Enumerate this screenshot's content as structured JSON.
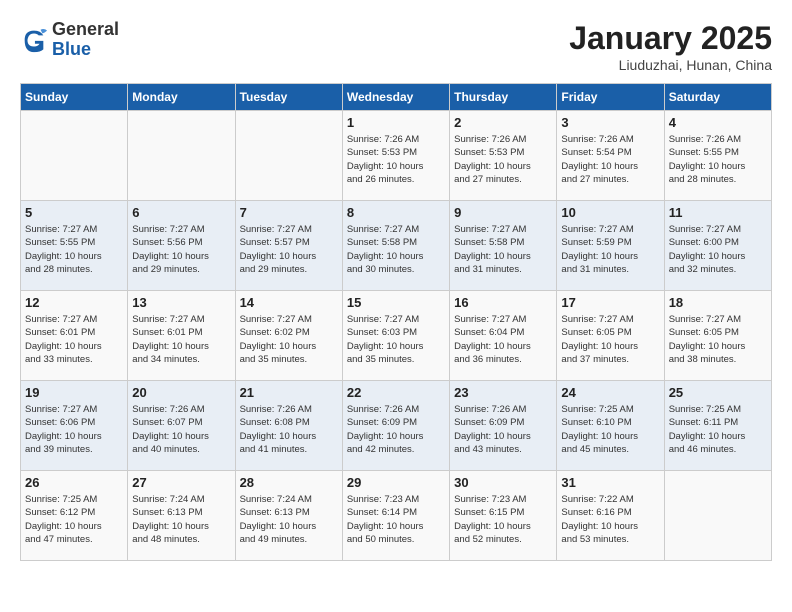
{
  "header": {
    "logo_general": "General",
    "logo_blue": "Blue",
    "title": "January 2025",
    "subtitle": "Liuduzhai, Hunan, China"
  },
  "weekdays": [
    "Sunday",
    "Monday",
    "Tuesday",
    "Wednesday",
    "Thursday",
    "Friday",
    "Saturday"
  ],
  "weeks": [
    [
      {
        "day": "",
        "info": ""
      },
      {
        "day": "",
        "info": ""
      },
      {
        "day": "",
        "info": ""
      },
      {
        "day": "1",
        "info": "Sunrise: 7:26 AM\nSunset: 5:53 PM\nDaylight: 10 hours\nand 26 minutes."
      },
      {
        "day": "2",
        "info": "Sunrise: 7:26 AM\nSunset: 5:53 PM\nDaylight: 10 hours\nand 27 minutes."
      },
      {
        "day": "3",
        "info": "Sunrise: 7:26 AM\nSunset: 5:54 PM\nDaylight: 10 hours\nand 27 minutes."
      },
      {
        "day": "4",
        "info": "Sunrise: 7:26 AM\nSunset: 5:55 PM\nDaylight: 10 hours\nand 28 minutes."
      }
    ],
    [
      {
        "day": "5",
        "info": "Sunrise: 7:27 AM\nSunset: 5:55 PM\nDaylight: 10 hours\nand 28 minutes."
      },
      {
        "day": "6",
        "info": "Sunrise: 7:27 AM\nSunset: 5:56 PM\nDaylight: 10 hours\nand 29 minutes."
      },
      {
        "day": "7",
        "info": "Sunrise: 7:27 AM\nSunset: 5:57 PM\nDaylight: 10 hours\nand 29 minutes."
      },
      {
        "day": "8",
        "info": "Sunrise: 7:27 AM\nSunset: 5:58 PM\nDaylight: 10 hours\nand 30 minutes."
      },
      {
        "day": "9",
        "info": "Sunrise: 7:27 AM\nSunset: 5:58 PM\nDaylight: 10 hours\nand 31 minutes."
      },
      {
        "day": "10",
        "info": "Sunrise: 7:27 AM\nSunset: 5:59 PM\nDaylight: 10 hours\nand 31 minutes."
      },
      {
        "day": "11",
        "info": "Sunrise: 7:27 AM\nSunset: 6:00 PM\nDaylight: 10 hours\nand 32 minutes."
      }
    ],
    [
      {
        "day": "12",
        "info": "Sunrise: 7:27 AM\nSunset: 6:01 PM\nDaylight: 10 hours\nand 33 minutes."
      },
      {
        "day": "13",
        "info": "Sunrise: 7:27 AM\nSunset: 6:01 PM\nDaylight: 10 hours\nand 34 minutes."
      },
      {
        "day": "14",
        "info": "Sunrise: 7:27 AM\nSunset: 6:02 PM\nDaylight: 10 hours\nand 35 minutes."
      },
      {
        "day": "15",
        "info": "Sunrise: 7:27 AM\nSunset: 6:03 PM\nDaylight: 10 hours\nand 35 minutes."
      },
      {
        "day": "16",
        "info": "Sunrise: 7:27 AM\nSunset: 6:04 PM\nDaylight: 10 hours\nand 36 minutes."
      },
      {
        "day": "17",
        "info": "Sunrise: 7:27 AM\nSunset: 6:05 PM\nDaylight: 10 hours\nand 37 minutes."
      },
      {
        "day": "18",
        "info": "Sunrise: 7:27 AM\nSunset: 6:05 PM\nDaylight: 10 hours\nand 38 minutes."
      }
    ],
    [
      {
        "day": "19",
        "info": "Sunrise: 7:27 AM\nSunset: 6:06 PM\nDaylight: 10 hours\nand 39 minutes."
      },
      {
        "day": "20",
        "info": "Sunrise: 7:26 AM\nSunset: 6:07 PM\nDaylight: 10 hours\nand 40 minutes."
      },
      {
        "day": "21",
        "info": "Sunrise: 7:26 AM\nSunset: 6:08 PM\nDaylight: 10 hours\nand 41 minutes."
      },
      {
        "day": "22",
        "info": "Sunrise: 7:26 AM\nSunset: 6:09 PM\nDaylight: 10 hours\nand 42 minutes."
      },
      {
        "day": "23",
        "info": "Sunrise: 7:26 AM\nSunset: 6:09 PM\nDaylight: 10 hours\nand 43 minutes."
      },
      {
        "day": "24",
        "info": "Sunrise: 7:25 AM\nSunset: 6:10 PM\nDaylight: 10 hours\nand 45 minutes."
      },
      {
        "day": "25",
        "info": "Sunrise: 7:25 AM\nSunset: 6:11 PM\nDaylight: 10 hours\nand 46 minutes."
      }
    ],
    [
      {
        "day": "26",
        "info": "Sunrise: 7:25 AM\nSunset: 6:12 PM\nDaylight: 10 hours\nand 47 minutes."
      },
      {
        "day": "27",
        "info": "Sunrise: 7:24 AM\nSunset: 6:13 PM\nDaylight: 10 hours\nand 48 minutes."
      },
      {
        "day": "28",
        "info": "Sunrise: 7:24 AM\nSunset: 6:13 PM\nDaylight: 10 hours\nand 49 minutes."
      },
      {
        "day": "29",
        "info": "Sunrise: 7:23 AM\nSunset: 6:14 PM\nDaylight: 10 hours\nand 50 minutes."
      },
      {
        "day": "30",
        "info": "Sunrise: 7:23 AM\nSunset: 6:15 PM\nDaylight: 10 hours\nand 52 minutes."
      },
      {
        "day": "31",
        "info": "Sunrise: 7:22 AM\nSunset: 6:16 PM\nDaylight: 10 hours\nand 53 minutes."
      },
      {
        "day": "",
        "info": ""
      }
    ]
  ]
}
